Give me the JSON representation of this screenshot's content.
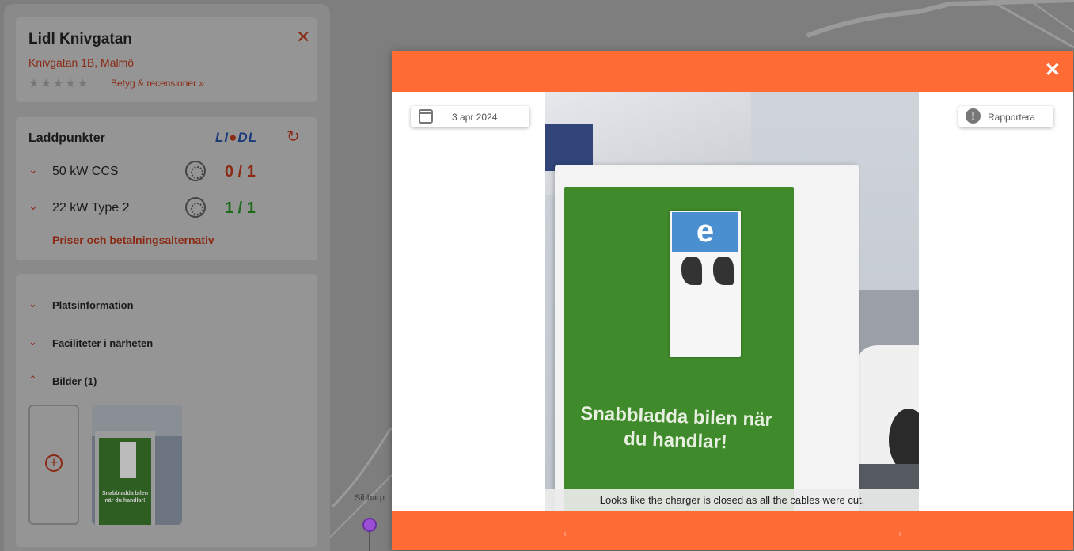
{
  "station": {
    "name": "Lidl Knivgatan",
    "address": "Knivgatan 1B, Malmö",
    "stars": "★★★★★",
    "ratings_link": "Betyg & recensioner »"
  },
  "laddpunkter": {
    "title": "Laddpunkter",
    "operator_logo": "LIDL",
    "rows": [
      {
        "power": "50 kW CCS",
        "count": "0 / 1",
        "status": "occupied"
      },
      {
        "power": "22 kW Type 2",
        "count": "1 / 1",
        "status": "available"
      }
    ],
    "prices_link": "Priser och betalningsalternativ"
  },
  "sections": {
    "platsinfo": "Platsinformation",
    "faciliteter": "Faciliteter i närheten",
    "bilder": "Bilder (1)"
  },
  "map": {
    "place_label": "Sibbarp"
  },
  "photo_modal": {
    "date": "3 apr 2024",
    "report_label": "Rapportera",
    "caption": "Looks like the charger is closed as all the cables were cut.",
    "photo_text": {
      "logo": "e",
      "slogan": "Snabbladda bilen när du handlar!"
    }
  },
  "colors": {
    "accent": "#ff6b35",
    "link_red": "#c0391b",
    "available_green": "#1b8a1b"
  },
  "icons": {
    "close": "close-icon",
    "calendar": "calendar-icon",
    "report": "warning-icon",
    "prev": "arrow-left-icon",
    "next": "arrow-right-icon",
    "refresh": "refresh-icon",
    "chevron": "chevron-down-icon",
    "add": "add-circle-icon"
  }
}
